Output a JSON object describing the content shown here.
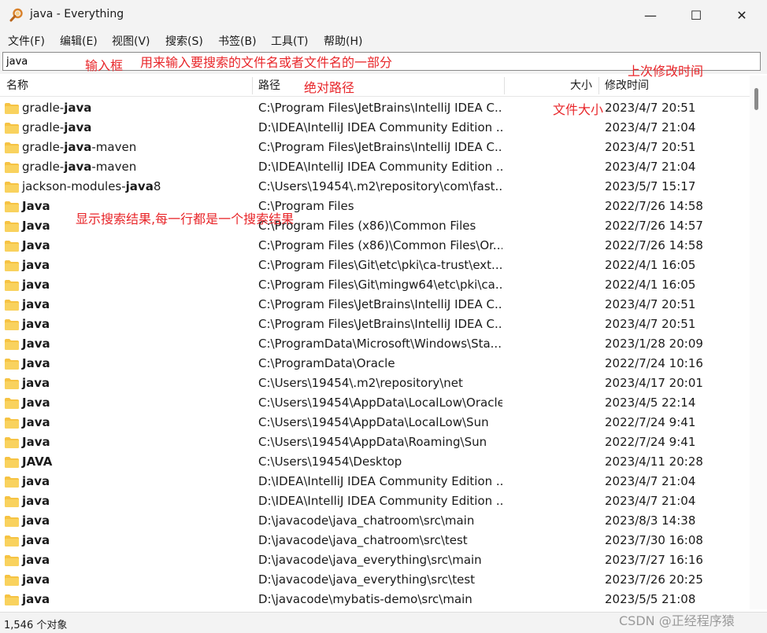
{
  "window": {
    "title": "java - Everything",
    "buttons": {
      "minimize": "—",
      "maximize": "☐",
      "close": "✕"
    }
  },
  "menu": [
    "文件(F)",
    "编辑(E)",
    "视图(V)",
    "搜索(S)",
    "书签(B)",
    "工具(T)",
    "帮助(H)"
  ],
  "search": {
    "value": "java"
  },
  "columns": {
    "name": "名称",
    "path": "路径",
    "size": "大小",
    "modified": "修改时间"
  },
  "rows": [
    {
      "pre": "gradle-",
      "match": "java",
      "post": "",
      "path": "C:\\Program Files\\JetBrains\\IntelliJ IDEA C...",
      "modified": "2023/4/7 20:51"
    },
    {
      "pre": "gradle-",
      "match": "java",
      "post": "",
      "path": "D:\\IDEA\\IntelliJ IDEA Community Edition ...",
      "modified": "2023/4/7 21:04"
    },
    {
      "pre": "gradle-",
      "match": "java",
      "post": "-maven",
      "path": "C:\\Program Files\\JetBrains\\IntelliJ IDEA C...",
      "modified": "2023/4/7 20:51"
    },
    {
      "pre": "gradle-",
      "match": "java",
      "post": "-maven",
      "path": "D:\\IDEA\\IntelliJ IDEA Community Edition ...",
      "modified": "2023/4/7 21:04"
    },
    {
      "pre": "jackson-modules-",
      "match": "java",
      "post": "8",
      "path": "C:\\Users\\19454\\.m2\\repository\\com\\fast...",
      "modified": "2023/5/7 15:17"
    },
    {
      "pre": "",
      "match": "Java",
      "post": "",
      "path": "C:\\Program Files",
      "modified": "2022/7/26 14:58"
    },
    {
      "pre": "",
      "match": "Java",
      "post": "",
      "path": "C:\\Program Files (x86)\\Common Files",
      "modified": "2022/7/26 14:57"
    },
    {
      "pre": "",
      "match": "Java",
      "post": "",
      "path": "C:\\Program Files (x86)\\Common Files\\Or...",
      "modified": "2022/7/26 14:58"
    },
    {
      "pre": "",
      "match": "java",
      "post": "",
      "path": "C:\\Program Files\\Git\\etc\\pki\\ca-trust\\ext...",
      "modified": "2022/4/1 16:05"
    },
    {
      "pre": "",
      "match": "java",
      "post": "",
      "path": "C:\\Program Files\\Git\\mingw64\\etc\\pki\\ca...",
      "modified": "2022/4/1 16:05"
    },
    {
      "pre": "",
      "match": "java",
      "post": "",
      "path": "C:\\Program Files\\JetBrains\\IntelliJ IDEA C...",
      "modified": "2023/4/7 20:51"
    },
    {
      "pre": "",
      "match": "java",
      "post": "",
      "path": "C:\\Program Files\\JetBrains\\IntelliJ IDEA C...",
      "modified": "2023/4/7 20:51"
    },
    {
      "pre": "",
      "match": "Java",
      "post": "",
      "path": "C:\\ProgramData\\Microsoft\\Windows\\Sta...",
      "modified": "2023/1/28 20:09"
    },
    {
      "pre": "",
      "match": "Java",
      "post": "",
      "path": "C:\\ProgramData\\Oracle",
      "modified": "2022/7/24 10:16"
    },
    {
      "pre": "",
      "match": "java",
      "post": "",
      "path": "C:\\Users\\19454\\.m2\\repository\\net",
      "modified": "2023/4/17 20:01"
    },
    {
      "pre": "",
      "match": "Java",
      "post": "",
      "path": "C:\\Users\\19454\\AppData\\LocalLow\\Oracle",
      "modified": "2023/4/5 22:14"
    },
    {
      "pre": "",
      "match": "Java",
      "post": "",
      "path": "C:\\Users\\19454\\AppData\\LocalLow\\Sun",
      "modified": "2022/7/24 9:41"
    },
    {
      "pre": "",
      "match": "Java",
      "post": "",
      "path": "C:\\Users\\19454\\AppData\\Roaming\\Sun",
      "modified": "2022/7/24 9:41"
    },
    {
      "pre": "",
      "match": "JAVA",
      "post": "",
      "path": "C:\\Users\\19454\\Desktop",
      "modified": "2023/4/11 20:28"
    },
    {
      "pre": "",
      "match": "java",
      "post": "",
      "path": "D:\\IDEA\\IntelliJ IDEA Community Edition ...",
      "modified": "2023/4/7 21:04"
    },
    {
      "pre": "",
      "match": "java",
      "post": "",
      "path": "D:\\IDEA\\IntelliJ IDEA Community Edition ...",
      "modified": "2023/4/7 21:04"
    },
    {
      "pre": "",
      "match": "java",
      "post": "",
      "path": "D:\\javacode\\java_chatroom\\src\\main",
      "modified": "2023/8/3 14:38"
    },
    {
      "pre": "",
      "match": "java",
      "post": "",
      "path": "D:\\javacode\\java_chatroom\\src\\test",
      "modified": "2023/7/30 16:08"
    },
    {
      "pre": "",
      "match": "java",
      "post": "",
      "path": "D:\\javacode\\java_everything\\src\\main",
      "modified": "2023/7/27 16:16"
    },
    {
      "pre": "",
      "match": "java",
      "post": "",
      "path": "D:\\javacode\\java_everything\\src\\test",
      "modified": "2023/7/26 20:25"
    },
    {
      "pre": "",
      "match": "java",
      "post": "",
      "path": "D:\\javacode\\mybatis-demo\\src\\main",
      "modified": "2023/5/5 21:08"
    }
  ],
  "status": {
    "text": "1,546 个对象"
  },
  "annotations": {
    "input_box": "输入框",
    "input_desc": "用来输入要搜索的文件名或者文件名的一部分",
    "abs_path": "绝对路径",
    "last_modified": "上次修改时间",
    "file_size": "文件大小",
    "results": "显示搜索结果,每一行都是一个搜索结果"
  },
  "watermark": "CSDN @正经程序猿",
  "colors": {
    "annotation": "#e8262a",
    "folder": "#f6c343",
    "chrome": "#f3f3f3"
  }
}
